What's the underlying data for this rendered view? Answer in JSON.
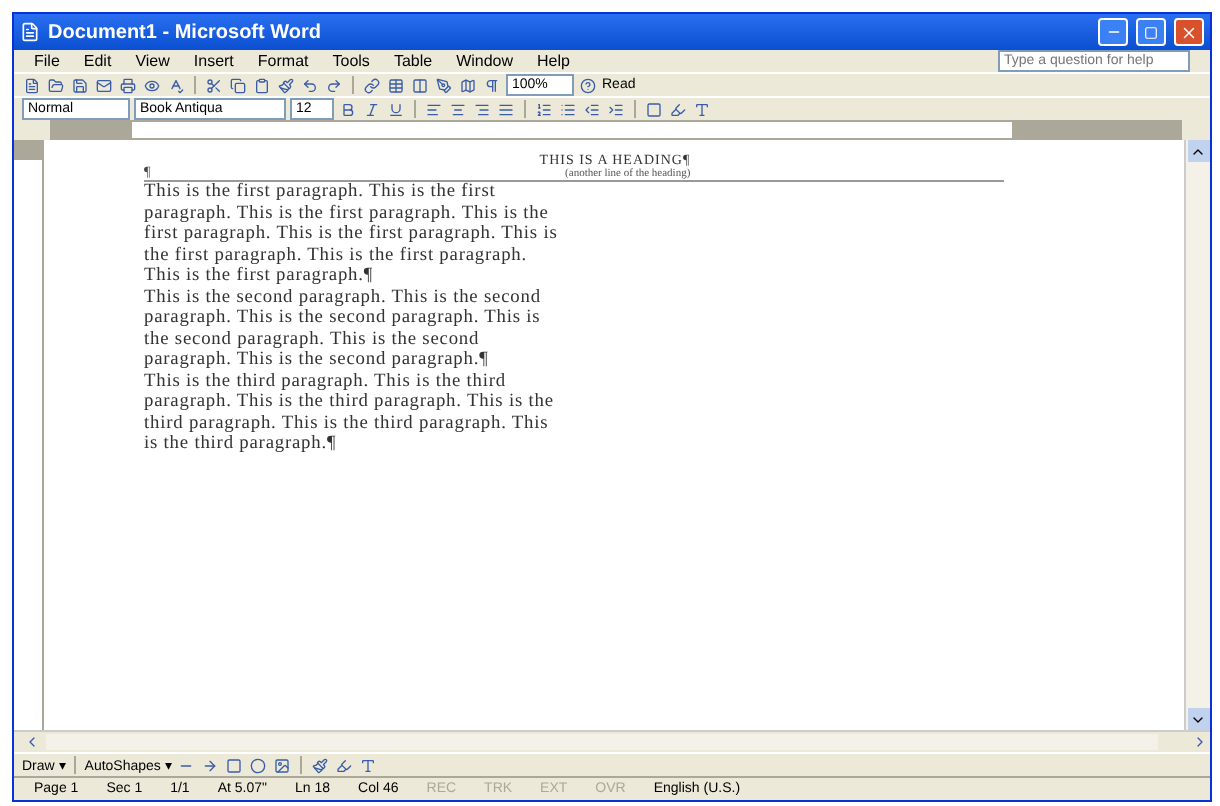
{
  "window": {
    "title": "Document1 - Microsoft Word"
  },
  "menu": [
    "File",
    "Edit",
    "View",
    "Insert",
    "Format",
    "Tools",
    "Table",
    "Window",
    "Help"
  ],
  "help_box": {
    "placeholder": "Type a question for help"
  },
  "standard_toolbar": {
    "zoom": "100%",
    "read": "Read"
  },
  "formatting_toolbar": {
    "style": "Normal",
    "font": "Book Antiqua",
    "size": "12"
  },
  "document": {
    "heading": "THIS IS A HEADING¶",
    "subheading": "(another line of the heading)",
    "heading_mark": "¶",
    "paragraphs": [
      "This is the first paragraph. This is the first paragraph. This is the first paragraph. This is the first paragraph. This is the first paragraph. This is the first paragraph. This is the first paragraph. This is the first paragraph.¶",
      "This is the second paragraph. This is the second paragraph. This is the second paragraph. This is the second paragraph. This is the second paragraph. This is the second paragraph.¶",
      "This is the third paragraph. This is the third paragraph. This is the third paragraph. This is the third paragraph. This is the third paragraph. This is the third paragraph.¶"
    ]
  },
  "drawing_toolbar": {
    "draw": "Draw ▾",
    "autoshapes": "AutoShapes ▾"
  },
  "status_bar": [
    {
      "text": "Page 1",
      "dim": false
    },
    {
      "text": "Sec 1",
      "dim": false
    },
    {
      "text": "1/1",
      "dim": false
    },
    {
      "text": "At 5.07\"",
      "dim": false
    },
    {
      "text": "Ln 18",
      "dim": false
    },
    {
      "text": "Col 46",
      "dim": false
    },
    {
      "text": "REC",
      "dim": true
    },
    {
      "text": "TRK",
      "dim": true
    },
    {
      "text": "EXT",
      "dim": true
    },
    {
      "text": "OVR",
      "dim": true
    },
    {
      "text": "English (U.S.)",
      "dim": false
    }
  ]
}
